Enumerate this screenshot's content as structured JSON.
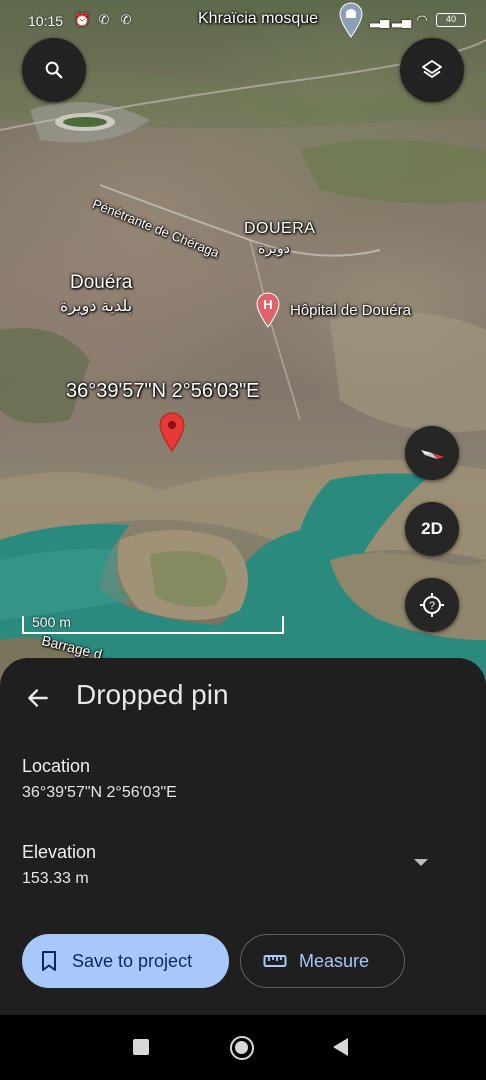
{
  "status_bar": {
    "time": "10:15",
    "battery": "40"
  },
  "map": {
    "labels": {
      "mosque": "Khraïcia mosque",
      "road": "Pénétrante de Chéraga",
      "douera_caps": "DOUERA",
      "douera_caps_ar": "دويرة",
      "douera": "Douéra",
      "douera_ar": "بلدية دويرة",
      "hopital": "Hôpital de Douéra",
      "coords": "36°39'57\"N 2°56'03\"E",
      "barrage": "Barrage d..."
    },
    "scale_text": "500 m",
    "view_mode_label": "2D",
    "icons": {
      "search": "search-icon",
      "layers": "layers-icon",
      "compass": "compass-icon",
      "locate": "my-location-icon",
      "dropped_pin": "map-pin-icon",
      "hospital": "hospital-pin-icon",
      "mosque": "mosque-pin-icon"
    }
  },
  "sheet": {
    "title": "Dropped pin",
    "location_label": "Location",
    "location_value": "36°39'57\"N 2°56'03\"E",
    "elevation_label": "Elevation",
    "elevation_value": "153.33 m",
    "save_button": "Save to project",
    "measure_button": "Measure"
  },
  "colors": {
    "primary_button_bg": "#a8c7fa",
    "primary_button_text": "#0b2a5b",
    "accent_text": "#a8c7fa",
    "sheet_bg": "#1f1f1f",
    "pin_red": "#e53935",
    "water": "#2a8a7e"
  }
}
